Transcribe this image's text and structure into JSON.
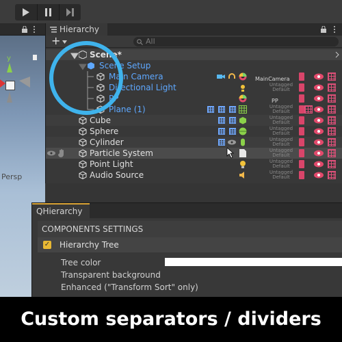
{
  "toolbar": {
    "play": "▶",
    "pause": "❚❚",
    "step": "▶❚"
  },
  "scene_view": {
    "persp_label": "Persp",
    "axis_y": "y"
  },
  "hierarchy": {
    "tab_title": "Hierarchy",
    "add_label": "+",
    "search_placeholder": "All",
    "scene_name": "Scene*",
    "rows": [
      {
        "name": "Scene Setup",
        "color": "blue"
      },
      {
        "name": "Main Camera",
        "color": "blue",
        "tag": "Untagged",
        "layer": "Default",
        "extra": "MainCamera"
      },
      {
        "name": "Directional Light",
        "color": "blue",
        "tag": "Untagged",
        "layer": "Default"
      },
      {
        "name": "PP",
        "color": "blue",
        "tag": "Untagged",
        "layer": "Default",
        "extra": "PP"
      },
      {
        "name": "Plane (1)",
        "color": "blue",
        "tag": "Untagged",
        "layer": "Default"
      },
      {
        "name": "Cube",
        "color": "white",
        "tag": "Untagged",
        "layer": "Default"
      },
      {
        "name": "Sphere",
        "color": "white",
        "tag": "Untagged",
        "layer": "Default"
      },
      {
        "name": "Cylinder",
        "color": "white",
        "tag": "Untagged",
        "layer": "Default"
      },
      {
        "name": "Particle System",
        "color": "white",
        "tag": "Untagged",
        "layer": "Default"
      },
      {
        "name": "Point Light",
        "color": "white",
        "tag": "Untagged",
        "layer": "Default"
      },
      {
        "name": "Audio Source",
        "color": "white",
        "tag": "Untagged",
        "layer": "Default"
      }
    ]
  },
  "qhierarchy": {
    "tab_title": "QHierarchy",
    "section_header": "COMPONENTS SETTINGS",
    "tree_label": "Hierarchy Tree",
    "tree_enabled": true,
    "options": [
      "Tree color",
      "Transparent background",
      "Enhanced (\"Transform Sort\" only)"
    ]
  },
  "caption": "Custom separators / dividers",
  "colors": {
    "accent_circle": "#3fb3ec",
    "blue_text": "#5ea8ff",
    "red_icon": "#d9456a",
    "check_yellow": "#e8b833"
  }
}
